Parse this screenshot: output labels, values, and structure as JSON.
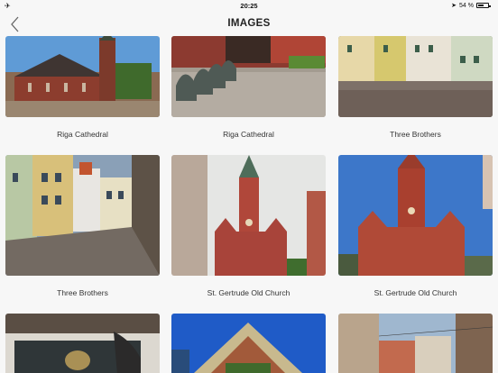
{
  "status": {
    "time": "20:25",
    "battery": "54 %",
    "battery_level": 0.54
  },
  "nav": {
    "title": "IMAGES"
  },
  "gallery": [
    {
      "caption": "Riga Cathedral"
    },
    {
      "caption": "Riga Cathedral"
    },
    {
      "caption": "Three Brothers"
    },
    {
      "caption": "Three Brothers"
    },
    {
      "caption": "St. Gertrude Old Church"
    },
    {
      "caption": "St. Gertrude Old Church"
    },
    {
      "caption": ""
    },
    {
      "caption": ""
    },
    {
      "caption": ""
    }
  ]
}
